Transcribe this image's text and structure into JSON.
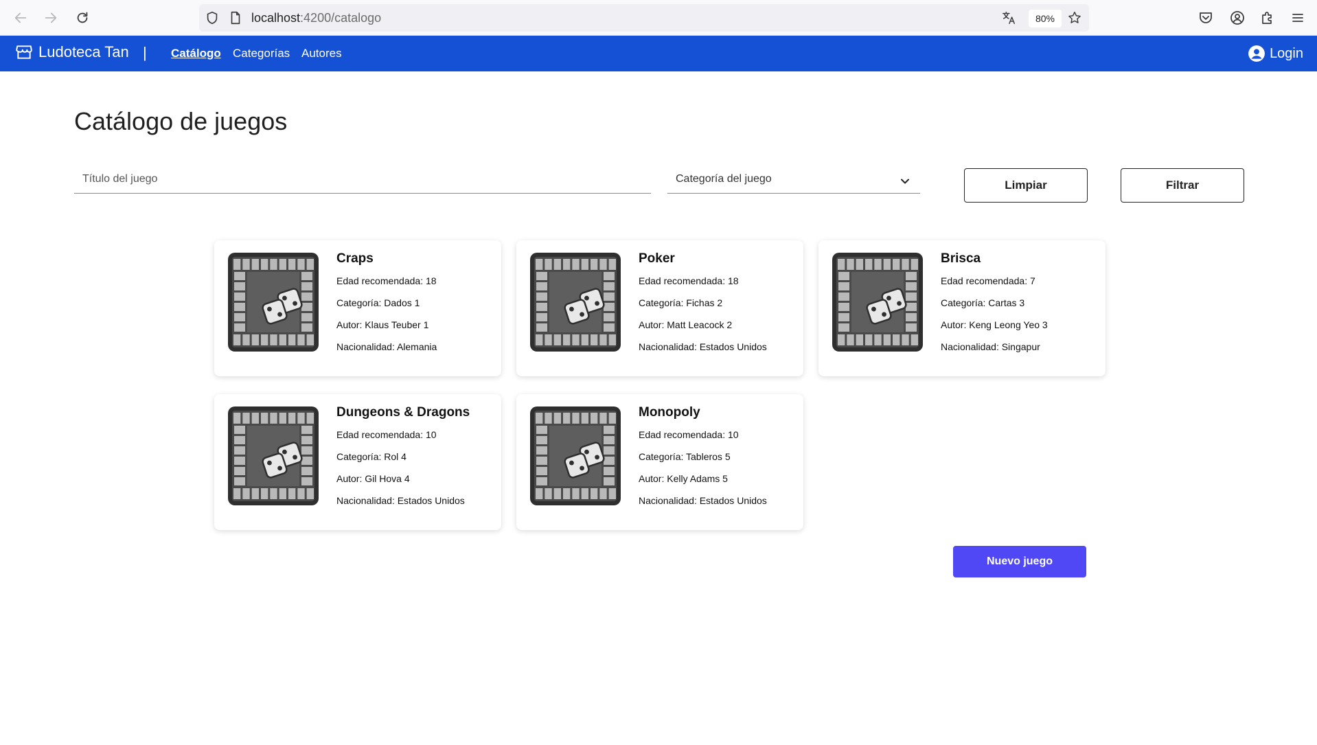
{
  "browser": {
    "url_host": "localhost",
    "url_path": ":4200/catalogo",
    "zoom": "80%",
    "icons": [
      "back-arrow-icon",
      "forward-arrow-icon",
      "reload-icon",
      "shield-icon",
      "page-icon",
      "translate-icon",
      "star-icon",
      "pocket-icon",
      "account-icon",
      "extensions-icon",
      "menu-icon"
    ]
  },
  "header": {
    "brand": "Ludoteca Tan",
    "separator": "|",
    "nav": [
      {
        "label": "Catálogo",
        "active": true
      },
      {
        "label": "Categorías",
        "active": false
      },
      {
        "label": "Autores",
        "active": false
      }
    ],
    "login": "Login",
    "bg_color": "#1551d4"
  },
  "main": {
    "title": "Catálogo de juegos",
    "filters": {
      "title_placeholder": "Título del juego",
      "category_placeholder": "Categoría del juego",
      "clear_label": "Limpiar",
      "filter_label": "Filtrar"
    },
    "new_game_label": "Nuevo juego",
    "primary_color": "#5048f5"
  },
  "games": [
    {
      "title": "Craps",
      "age": "Edad recomendada: 18",
      "category": "Categoría: Dados 1",
      "author": "Autor: Klaus Teuber 1",
      "nationality": "Nacionalidad: Alemania"
    },
    {
      "title": "Poker",
      "age": "Edad recomendada: 18",
      "category": "Categoría: Fichas 2",
      "author": "Autor: Matt Leacock 2",
      "nationality": "Nacionalidad: Estados Unidos"
    },
    {
      "title": "Brisca",
      "age": "Edad recomendada: 7",
      "category": "Categoría: Cartas 3",
      "author": "Autor: Keng Leong Yeo 3",
      "nationality": "Nacionalidad: Singapur"
    },
    {
      "title": "Dungeons & Dragons",
      "age": "Edad recomendada: 10",
      "category": "Categoría: Rol 4",
      "author": "Autor: Gil Hova 4",
      "nationality": "Nacionalidad: Estados Unidos"
    },
    {
      "title": "Monopoly",
      "age": "Edad recomendada: 10",
      "category": "Categoría: Tableros 5",
      "author": "Autor: Kelly Adams 5",
      "nationality": "Nacionalidad: Estados Unidos"
    }
  ]
}
